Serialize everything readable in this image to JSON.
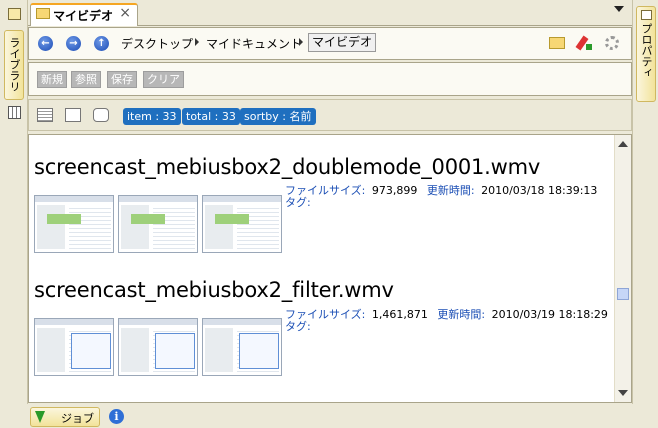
{
  "left_sidebar": {
    "tab_label": "ライブラリ"
  },
  "right_sidebar": {
    "tab_label": "プロパティ"
  },
  "tab": {
    "label": "マイビデオ",
    "close": "×"
  },
  "nav": {
    "back": "←",
    "forward": "→",
    "up": "↑",
    "breadcrumbs": [
      "デスクトップ",
      "マイドキュメント",
      "マイビデオ"
    ]
  },
  "toolbar": {
    "new": "新規",
    "ref": "参照",
    "save": "保存",
    "clear": "クリア"
  },
  "badges": {
    "item": "item : 33",
    "total": "total : 33",
    "sortby": "sortby : 名前"
  },
  "files": [
    {
      "name": "screencast_mebiusbox2_doublemode_0001.wmv",
      "size_label": "ファイルサイズ:",
      "size": "973,899",
      "mtime_label": "更新時間:",
      "mtime": "2010/03/18 18:39:13",
      "tag_label": "タグ:"
    },
    {
      "name": "screencast_mebiusbox2_filter.wmv",
      "size_label": "ファイルサイズ:",
      "size": "1,461,871",
      "mtime_label": "更新時間:",
      "mtime": "2010/03/19 18:18:29",
      "tag_label": "タグ:"
    }
  ],
  "status": {
    "job_label": "ジョブ",
    "info": "i"
  },
  "colors": {
    "accent": "#f5a623",
    "badge": "#1f6fbf",
    "label_blue": "#1c4fb5"
  }
}
